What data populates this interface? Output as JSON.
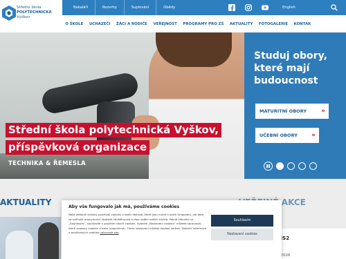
{
  "brand": {
    "line1": "Střední škola",
    "line2": "POLYTECHNICKÁ",
    "line3": "Vyškov",
    "colors": {
      "primary": "#2e7fc0",
      "dark": "#1e5f94",
      "accent": "#c8102e"
    }
  },
  "topbar": {
    "links": [
      "Bakaláři",
      "Rozvrhy",
      "Suplování",
      "Obědy"
    ],
    "social": [
      "facebook-icon",
      "instagram-icon",
      "youtube-icon"
    ],
    "language": "English",
    "search_icon": "search-icon"
  },
  "nav": {
    "items": [
      "O ŠKOLE",
      "UCHAZEČI",
      "ŽÁCI A RODIČE",
      "VEŘEJNOST",
      "PROGRAMY PRO ZŠ",
      "AKTUALITY",
      "FOTOGALERIE",
      "KONTAK"
    ]
  },
  "hero": {
    "title_line1": "Střední škola polytechnická Vyškov,",
    "title_line2": "příspěvková organizace",
    "subtitle": "TECHNIKA & ŘEMESLA"
  },
  "promo": {
    "title": "Studuj obory, které mají budoucnost",
    "buttons": [
      {
        "label": "MATURITNÍ OBORY",
        "arrow": "»"
      },
      {
        "label": "UČEBNÍ OBORY",
        "arrow": "»"
      }
    ],
    "slides": {
      "count": 4,
      "active": 1
    }
  },
  "sections": {
    "news_heading": "AKTUALITY",
    "events_heading": "VEŘEJNÉ AKCE",
    "event_name": "ní MZ NS2",
    "event_date": "4. června 2026"
  },
  "cookie": {
    "title": "Aby vše fungovalo jak má, používáme cookies",
    "text": "Naše webové stránky používají cookies a další nástroje, které jsou nutné k jejich fungování, ale také, se svěřujte anonymních statistik návštěvnosti a lépe vidění našich služeb. Pokud kliknete na „Souhlasím“, souhlasíte s použitím všech cookies. Vyberte „Nastavení cookies“ můžete spravovat, které soubory cookies chcete (nepovinné). Tímto nastavení můžete kdykoli změnit. Detailní informace o používaných cookies",
    "link": "naleznete zde",
    "accept_label": "Souhlasím",
    "settings_label": "Nastavení cookies"
  }
}
